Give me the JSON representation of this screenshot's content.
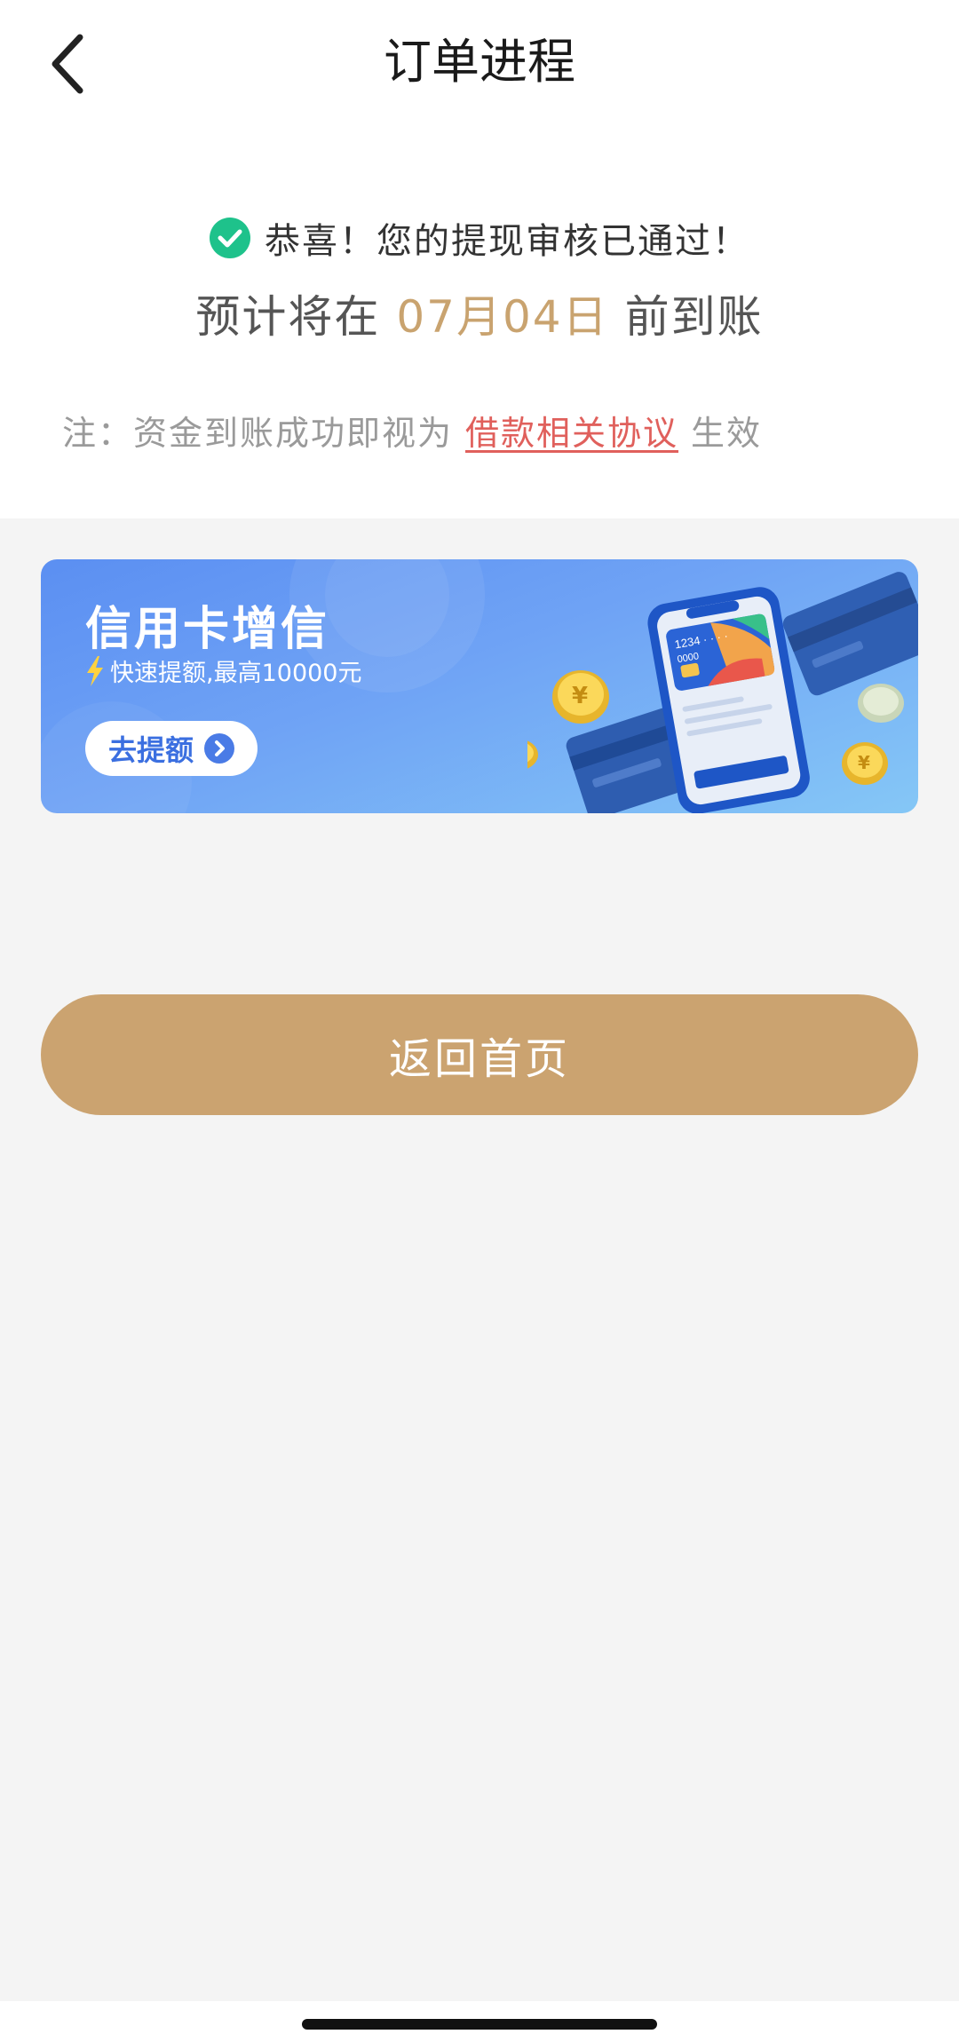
{
  "header": {
    "title": "订单进程"
  },
  "status": {
    "message": "恭喜！您的提现审核已通过！",
    "eta_prefix": "预计将在",
    "eta_date": "07月04日",
    "eta_suffix": "前到账",
    "note_prefix": "注：资金到账成功即视为",
    "note_link": "借款相关协议",
    "note_suffix": "生效"
  },
  "banner": {
    "title": "信用卡增信",
    "subtitle": "快速提额,最高10000元",
    "button_label": "去提额",
    "card_number_top": "1234 · · · ·",
    "card_number_bottom": "0000"
  },
  "actions": {
    "home_label": "返回首页"
  },
  "colors": {
    "accent_gold": "#cba370",
    "success_green": "#1ec28b",
    "link_red": "#e0605c",
    "banner_blue": "#5b8ff2"
  },
  "icons": {
    "back": "chevron-left-icon",
    "success": "check-circle-icon",
    "bolt": "lightning-bolt-icon",
    "arrow": "arrow-right-circle-icon"
  }
}
